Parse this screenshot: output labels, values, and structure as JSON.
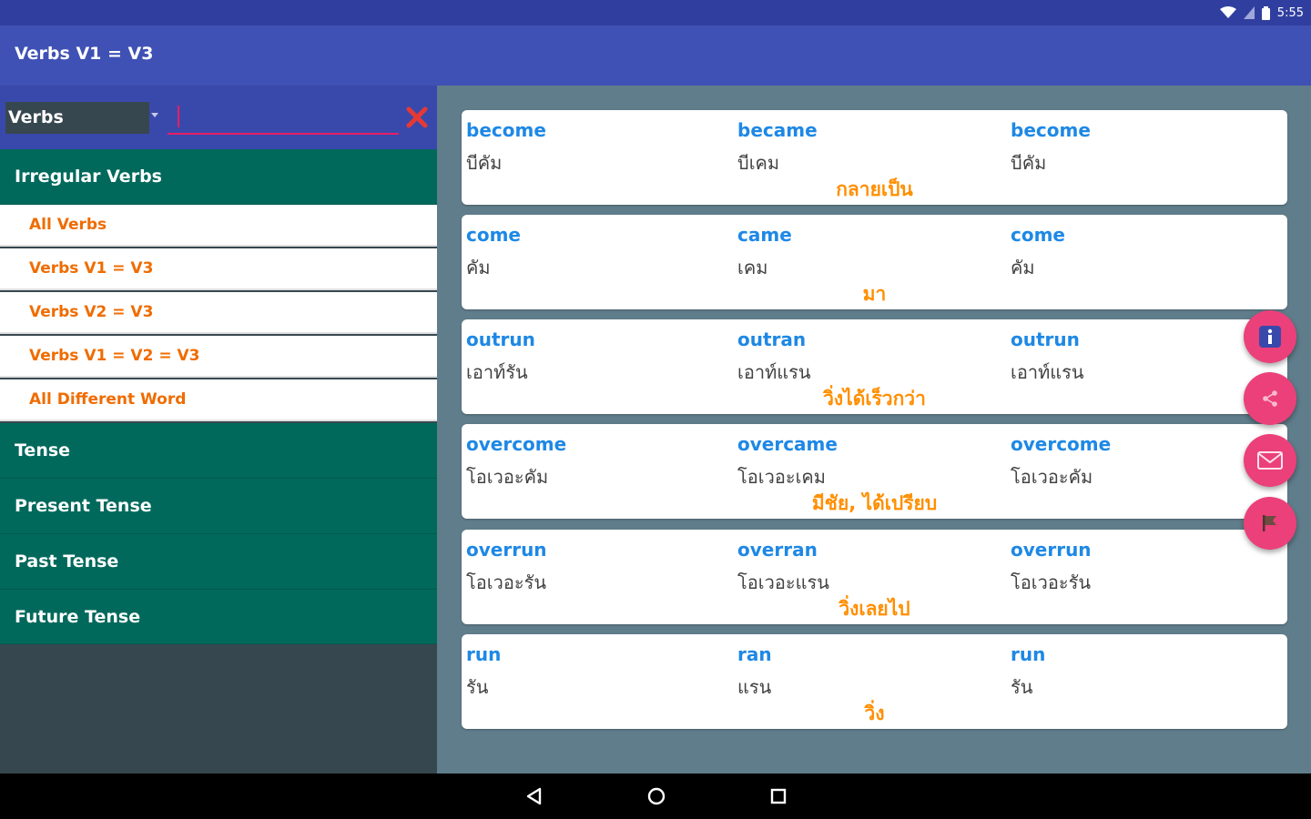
{
  "status": {
    "time": "5:55"
  },
  "appbar": {
    "title": "Verbs V1 = V3"
  },
  "search": {
    "category": "Verbs",
    "value": "",
    "placeholder": ""
  },
  "menu": {
    "irregular_header": "Irregular Verbs",
    "irregular_items": [
      "All Verbs",
      "Verbs V1 = V3",
      "Verbs V2 = V3",
      "Verbs V1 = V2 = V3",
      "All Different Word"
    ],
    "tense_header": "Tense",
    "tense_items": [
      "Present Tense",
      "Past Tense",
      "Future Tense"
    ]
  },
  "verbs": [
    {
      "v1": "become",
      "v1_th": "บีคัม",
      "v2": "became",
      "v2_th": "บีเคม",
      "v3": "become",
      "v3_th": "บีคัม",
      "meaning": "กลายเป็น"
    },
    {
      "v1": "come",
      "v1_th": "คัม",
      "v2": "came",
      "v2_th": "เคม",
      "v3": "come",
      "v3_th": "คัม",
      "meaning": "มา"
    },
    {
      "v1": "outrun",
      "v1_th": "เอาท์รัน",
      "v2": "outran",
      "v2_th": "เอาท์แรน",
      "v3": "outrun",
      "v3_th": "เอาท์แรน",
      "meaning": "วิ่งได้เร็วกว่า"
    },
    {
      "v1": "overcome",
      "v1_th": "โอเวอะคัม",
      "v2": "overcame",
      "v2_th": "โอเวอะเคม",
      "v3": "overcome",
      "v3_th": "โอเวอะคัม",
      "meaning": "มีชัย, ได้เปรียบ"
    },
    {
      "v1": "overrun",
      "v1_th": "โอเวอะรัน",
      "v2": "overran",
      "v2_th": "โอเวอะแรน",
      "v3": "overrun",
      "v3_th": "โอเวอะรัน",
      "meaning": "วิ่งเลยไป"
    },
    {
      "v1": "run",
      "v1_th": "รัน",
      "v2": "ran",
      "v2_th": "แรน",
      "v3": "run",
      "v3_th": "รัน",
      "meaning": "วิ่ง"
    }
  ],
  "fabs": [
    "info-icon",
    "share-icon",
    "mail-icon",
    "flag-icon"
  ],
  "colors": {
    "status_bar": "#303f9f",
    "app_bar": "#3f51b5",
    "menu_header": "#00695c",
    "menu_item_text": "#ef6c00",
    "verb_text": "#1e88e5",
    "meaning_text": "#ff8f00",
    "fab": "#ec407a",
    "content_bg": "#607d8b"
  }
}
